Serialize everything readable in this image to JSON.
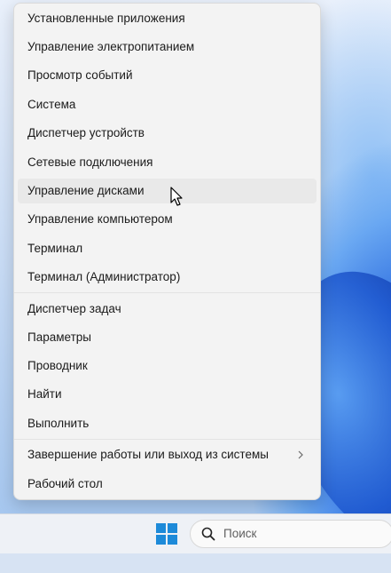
{
  "menu": {
    "items": [
      {
        "label": "Установленные приложения"
      },
      {
        "label": "Управление электропитанием"
      },
      {
        "label": "Просмотр событий"
      },
      {
        "label": "Система"
      },
      {
        "label": "Диспетчер устройств"
      },
      {
        "label": "Сетевые подключения"
      },
      {
        "label": "Управление дисками"
      },
      {
        "label": "Управление компьютером"
      },
      {
        "label": "Терминал"
      },
      {
        "label": "Терминал (Администратор)"
      },
      {
        "label": "Диспетчер задач"
      },
      {
        "label": "Параметры"
      },
      {
        "label": "Проводник"
      },
      {
        "label": "Найти"
      },
      {
        "label": "Выполнить"
      },
      {
        "label": "Завершение работы или выход из системы"
      },
      {
        "label": "Рабочий стол"
      }
    ]
  },
  "taskbar": {
    "search_placeholder": "Поиск"
  },
  "colors": {
    "accent": "#1d8ad9",
    "menu_background": "#f3f3f3",
    "hover_background": "#e9e9e9"
  },
  "icons": {
    "start": "windows-logo-icon",
    "search": "search-icon",
    "submenu": "chevron-right-icon",
    "pointer": "mouse-cursor-icon"
  }
}
